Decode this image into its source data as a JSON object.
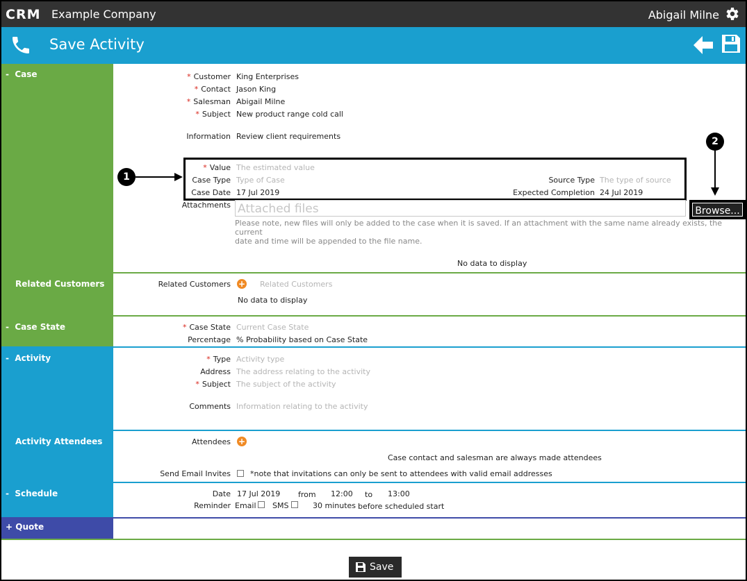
{
  "app": {
    "logo_text": "CRM",
    "company": "Example Company",
    "user": "Abigail Milne",
    "icons": [
      "gear-icon",
      "phone-icon",
      "back-arrow-icon",
      "save-icon"
    ]
  },
  "header": {
    "title": "Save Activity"
  },
  "sections": {
    "case": {
      "toggle": "-",
      "title": "Case"
    },
    "related_customers": {
      "title": "Related Customers"
    },
    "case_state": {
      "toggle": "-",
      "title": "Case State"
    },
    "activity": {
      "toggle": "-",
      "title": "Activity"
    },
    "activity_attendees": {
      "title": "Activity Attendees"
    },
    "schedule": {
      "toggle": "-",
      "title": "Schedule"
    },
    "quote": {
      "toggle": "+",
      "title": "Quote"
    }
  },
  "case": {
    "customer_label": "Customer",
    "customer_value": "King Enterprises",
    "contact_label": "Contact",
    "contact_value": "Jason King",
    "salesman_label": "Salesman",
    "salesman_value": "Abigail Milne",
    "subject_label": "Subject",
    "subject_value": "New product range cold call",
    "information_label": "Information",
    "information_value": "Review client requirements",
    "value_label": "Value",
    "value_placeholder": "The estimated value",
    "case_type_label": "Case Type",
    "case_type_placeholder": "Type of Case",
    "source_type_label": "Source Type",
    "source_type_placeholder": "The type of source",
    "case_date_label": "Case Date",
    "case_date_value": "17 Jul 2019",
    "expected_completion_label": "Expected Completion",
    "expected_completion_value": "24 Jul 2019",
    "attachments_label": "Attachments",
    "attachments_placeholder": "Attached files",
    "browse_label": "Browse...",
    "attachments_note_1": "Please note, new files will only be added to the case when it is saved. If an attachment with the same name already exists, the current",
    "attachments_note_2": "date and time will be appended to the file name.",
    "no_data": "No data to display"
  },
  "related_customers": {
    "label": "Related Customers",
    "placeholder": "Related Customers",
    "no_data": "No data to display"
  },
  "case_state": {
    "state_label": "Case State",
    "state_placeholder": "Current Case State",
    "percentage_label": "Percentage",
    "percentage_value": "% Probability based on Case State"
  },
  "activity": {
    "type_label": "Type",
    "type_placeholder": "Activity type",
    "address_label": "Address",
    "address_placeholder": "The address relating to the activity",
    "subject_label": "Subject",
    "subject_placeholder": "The subject of the activity",
    "comments_label": "Comments",
    "comments_placeholder": "Information relating to the activity"
  },
  "attendees": {
    "label": "Attendees",
    "note": "Case contact and salesman are always made attendees",
    "send_invites_label": "Send Email Invites",
    "send_invites_note": "*note that invitations can only be sent to attendees with valid email addresses"
  },
  "schedule": {
    "date_label": "Date",
    "date_value": "17 Jul 2019",
    "from_label": "from",
    "from_value": "12:00",
    "to_label": "to",
    "to_value": "13:00",
    "reminder_label": "Reminder",
    "email_label": "Email",
    "sms_label": "SMS",
    "minutes_value": "30 minutes",
    "before_label": "before scheduled start"
  },
  "annotations": {
    "callout_1": "1",
    "callout_2": "2"
  },
  "footer": {
    "save_label": "Save"
  },
  "required_marker": "*"
}
